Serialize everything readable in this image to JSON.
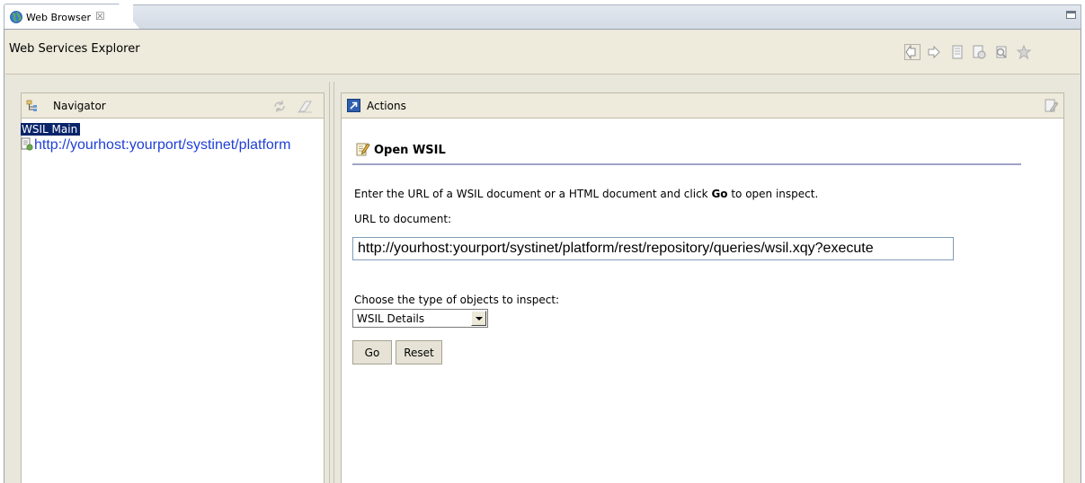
{
  "tab": {
    "label": "Web Browser",
    "close_glyph": "☒",
    "icon": "globe-icon"
  },
  "header": {
    "title": "Web Services Explorer",
    "toolbar_icons": [
      "back-icon",
      "forward-icon",
      "page-icon",
      "document-refresh-icon",
      "search-doc-icon",
      "favorites-star-icon"
    ]
  },
  "navigator": {
    "title": "Navigator",
    "items": [
      {
        "label": "WSIL Main",
        "selected": true
      },
      {
        "label": "http://yourhost:yourport/systinet/platform",
        "selected": false
      }
    ]
  },
  "actions": {
    "title": "Actions",
    "section_title": "Open WSIL",
    "instruction_before": "Enter the URL of a WSIL document or a HTML document and click ",
    "instruction_bold": "Go",
    "instruction_after": " to open inspect.",
    "url_label": "URL to document:",
    "url_value": "http://yourhost:yourport/systinet/platform/rest/repository/queries/wsil.xqy?execute",
    "choose_label": "Choose the type of objects to inspect:",
    "type_selected": "WSIL Details",
    "go_label": "Go",
    "reset_label": "Reset"
  },
  "colors": {
    "selection_bg": "#0a246a",
    "link": "#1f3fd6",
    "panel_header": "#eeeadc",
    "rule": "#9fa4c5"
  }
}
